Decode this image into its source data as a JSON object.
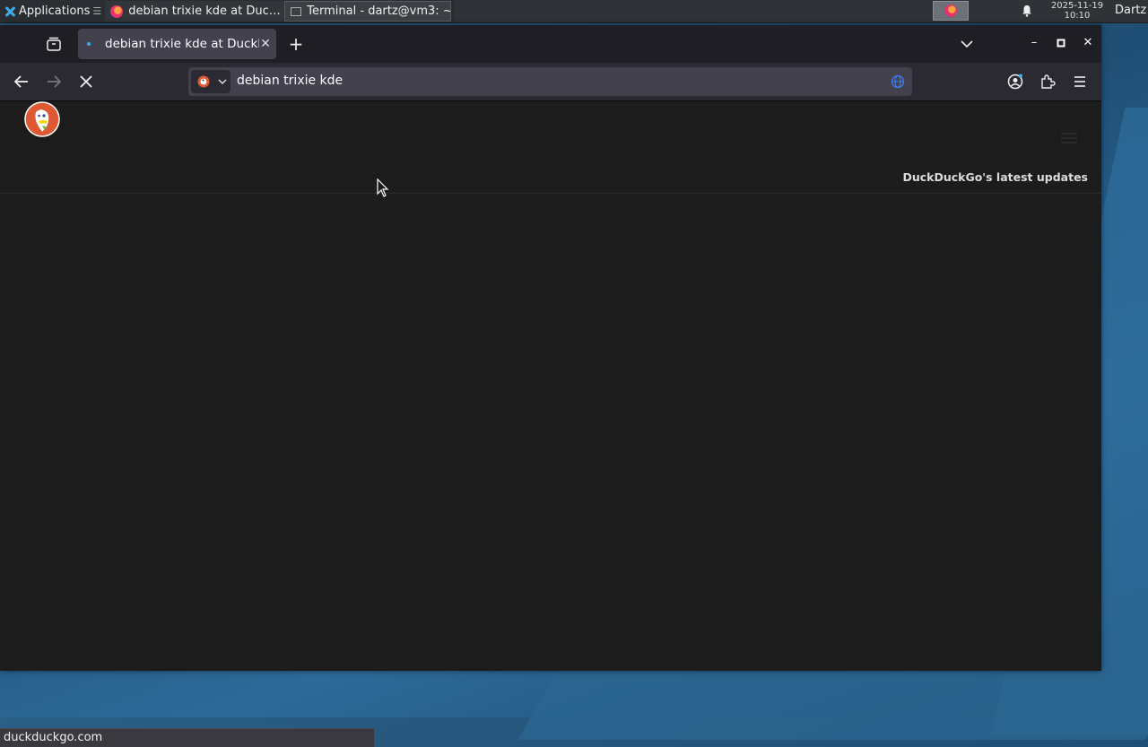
{
  "taskbar": {
    "applications_label": "Applications",
    "apps_menu_glyph": "☰",
    "tasks": [
      {
        "label": "debian trixie kde at Duc…",
        "icon": "firefox-icon"
      },
      {
        "label": "Terminal - dartz@vm3: ~",
        "icon": "terminal-icon"
      }
    ],
    "clock_date": "2025-11-19",
    "clock_time": "10:10",
    "user": "Dartz"
  },
  "browser": {
    "tab": {
      "title": "debian trixie kde at DuckDuckGo",
      "close_glyph": "✕"
    },
    "new_tab_glyph": "+",
    "window_controls": {
      "minimize": "–",
      "maximize": "▫",
      "close": "✕"
    },
    "address": {
      "value": "debian trixie kde"
    },
    "status_url": "duckduckgo.com"
  },
  "page": {
    "updates_link": "DuckDuckGo's latest updates"
  },
  "colors": {
    "accent": "#3daee9",
    "ddg_orange": "#de5833"
  }
}
